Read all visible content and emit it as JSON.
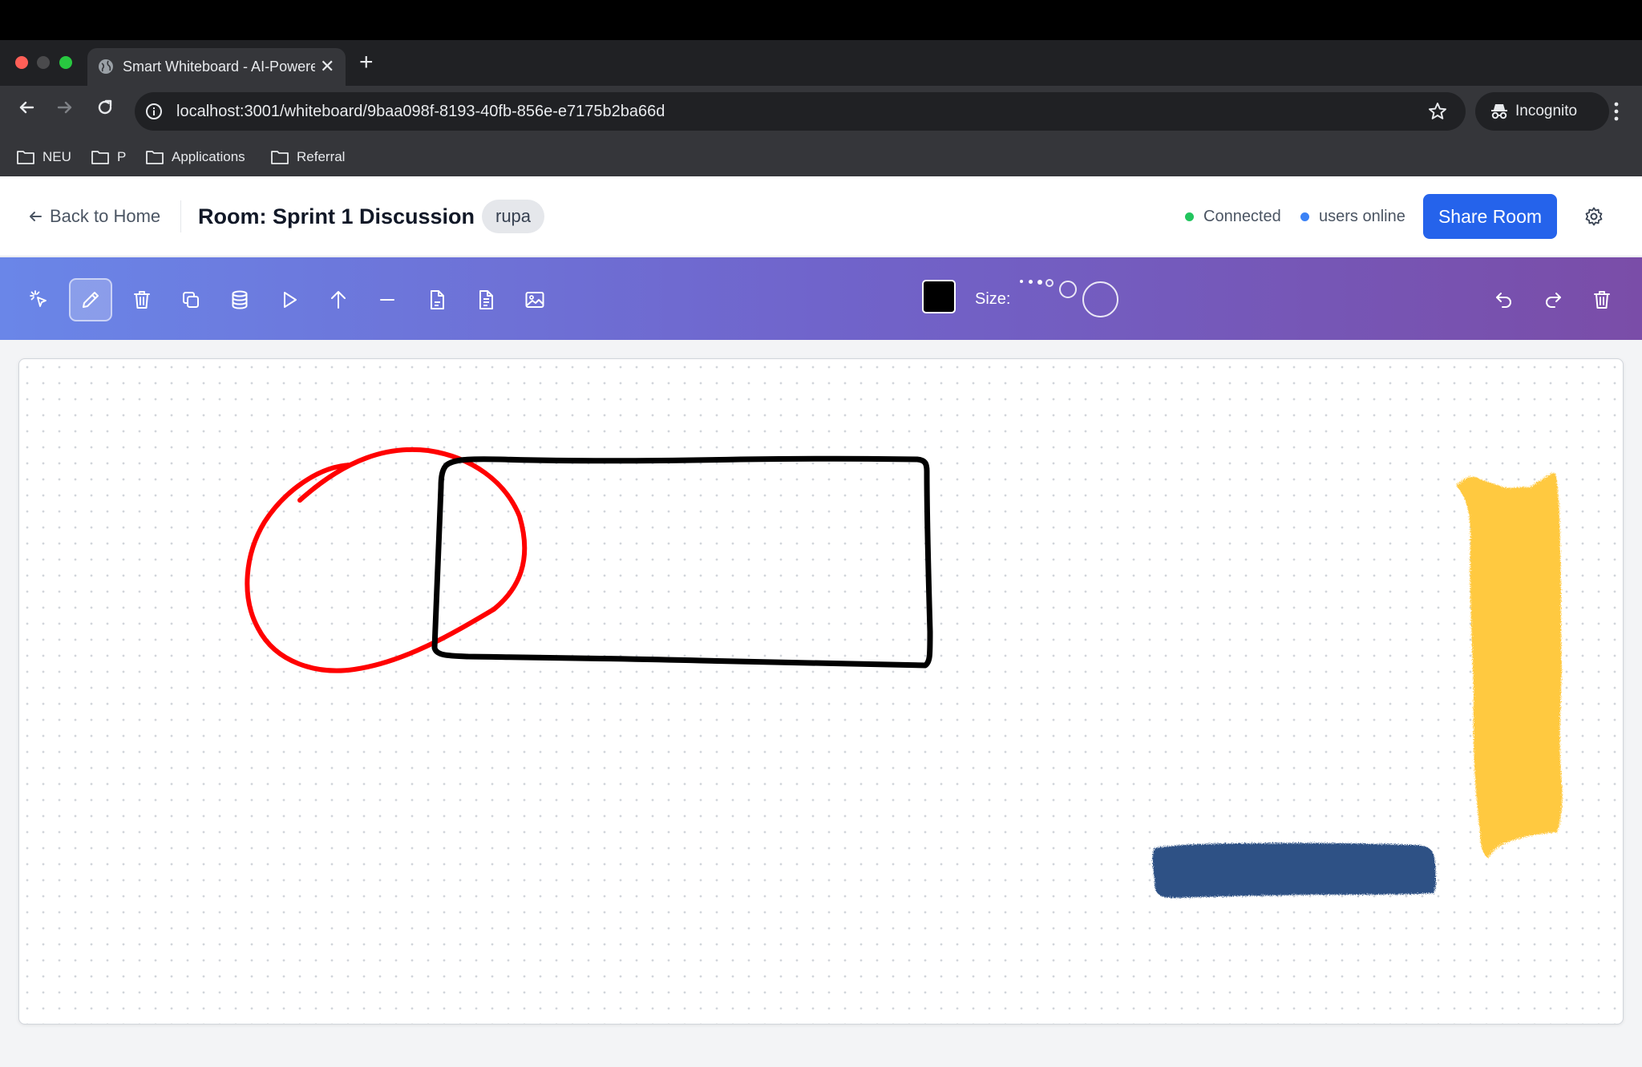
{
  "browser": {
    "tab_title": "Smart Whiteboard - AI-Powered",
    "tab_close": "✕",
    "new_tab": "+",
    "url": "localhost:3001/whiteboard/9baa098f-8193-40fb-856e-e7175b2ba66d",
    "incognito_label": "Incognito",
    "bookmarks": [
      "NEU",
      "P",
      "Applications",
      "Referral"
    ]
  },
  "header": {
    "back_label": "Back to Home",
    "room_title": "Room: Sprint 1 Discussion",
    "user_badge": "rupa",
    "status_connected": "Connected",
    "status_users": "users online",
    "share_label": "Share Room"
  },
  "toolbar": {
    "tools": [
      "ai-select-icon",
      "pencil-icon",
      "eraser-icon",
      "copy-icon",
      "database-icon",
      "play-icon",
      "arrow-up-icon",
      "line-icon",
      "document-icon",
      "text-document-icon",
      "image-icon"
    ],
    "active_tool": "pencil-icon",
    "size_label": "Size:",
    "selected_color": "#000000",
    "actions": [
      "undo-icon",
      "redo-icon",
      "clear-canvas-icon"
    ]
  },
  "colors": {
    "accent": "#2563eb",
    "connected": "#22c55e",
    "users": "#3b82f6",
    "stroke_red": "#ff0000",
    "stroke_black": "#000000",
    "brush_yellow": "#ffc940",
    "brush_blue": "#2e5185"
  }
}
